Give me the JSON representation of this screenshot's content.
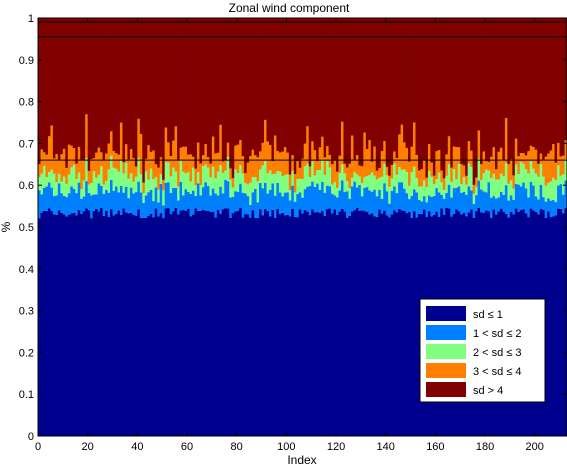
{
  "chart_data": {
    "type": "bar",
    "stacked": true,
    "title": "Zonal wind component",
    "xlabel": "Index",
    "ylabel": "%",
    "xlim": [
      0,
      213
    ],
    "ylim": [
      0,
      1
    ],
    "xticks": [
      "0",
      "20",
      "40",
      "60",
      "80",
      "100",
      "120",
      "140",
      "160",
      "180",
      "200"
    ],
    "yticks": [
      "0",
      "0.1",
      "0.2",
      "0.3",
      "0.4",
      "0.5",
      "0.6",
      "0.7",
      "0.8",
      "0.9",
      "1"
    ],
    "grid": false,
    "legend_position": "bottom-right",
    "reference_lines_y": [
      0.99,
      0.955,
      0.66
    ],
    "series": [
      {
        "name": "sd ≤ 1",
        "color": "#00008f"
      },
      {
        "name": "1 < sd ≤ 2",
        "color": "#0080ff"
      },
      {
        "name": "2 < sd ≤ 3",
        "color": "#80ff80"
      },
      {
        "name": "3 < sd ≤ 4",
        "color": "#ff8000"
      },
      {
        "name": "sd > 4",
        "color": "#800000"
      }
    ],
    "cumulative_boundaries_approx": {
      "sd_le_1": 0.53,
      "sd_le_2": 0.575,
      "sd_le_3": 0.615,
      "sd_le_4": 0.66,
      "total": 1.0
    }
  }
}
